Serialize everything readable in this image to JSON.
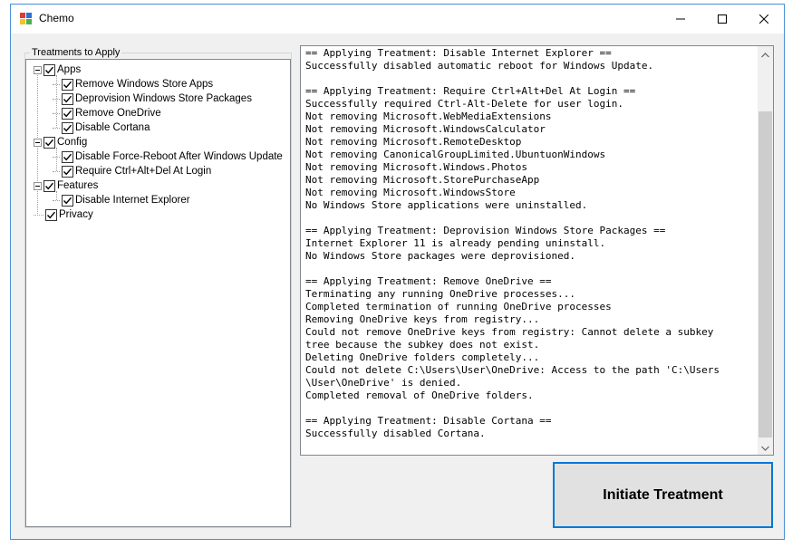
{
  "window": {
    "title": "Chemo",
    "icon": "chemo-app-icon",
    "controls": [
      "minimize-icon",
      "maximize-icon",
      "close-icon"
    ]
  },
  "treatments": {
    "group_label": "Treatments to Apply",
    "nodes": [
      {
        "label": "Apps",
        "checked": true,
        "expanded": true,
        "level": 0
      },
      {
        "label": "Remove Windows Store Apps",
        "checked": true,
        "level": 1
      },
      {
        "label": "Deprovision Windows Store Packages",
        "checked": true,
        "level": 1
      },
      {
        "label": "Remove OneDrive",
        "checked": true,
        "level": 1
      },
      {
        "label": "Disable Cortana",
        "checked": true,
        "level": 1
      },
      {
        "label": "Config",
        "checked": true,
        "expanded": true,
        "level": 0
      },
      {
        "label": "Disable Force-Reboot After Windows Update",
        "checked": true,
        "level": 1
      },
      {
        "label": "Require Ctrl+Alt+Del At Login",
        "checked": true,
        "level": 1
      },
      {
        "label": "Features",
        "checked": true,
        "expanded": true,
        "level": 0
      },
      {
        "label": "Disable Internet Explorer",
        "checked": true,
        "level": 1
      },
      {
        "label": "Privacy",
        "checked": true,
        "level": 0
      }
    ]
  },
  "log": {
    "lines": [
      "== Applying Treatment: Disable Internet Explorer ==",
      "Successfully disabled automatic reboot for Windows Update.",
      "",
      "== Applying Treatment: Require Ctrl+Alt+Del At Login ==",
      "Successfully required Ctrl-Alt-Delete for user login.",
      "Not removing Microsoft.WebMediaExtensions",
      "Not removing Microsoft.WindowsCalculator",
      "Not removing Microsoft.RemoteDesktop",
      "Not removing CanonicalGroupLimited.UbuntuonWindows",
      "Not removing Microsoft.Windows.Photos",
      "Not removing Microsoft.StorePurchaseApp",
      "Not removing Microsoft.WindowsStore",
      "No Windows Store applications were uninstalled.",
      "",
      "== Applying Treatment: Deprovision Windows Store Packages ==",
      "Internet Explorer 11 is already pending uninstall.",
      "No Windows Store packages were deprovisioned.",
      "",
      "== Applying Treatment: Remove OneDrive ==",
      "Terminating any running OneDrive processes...",
      "Completed termination of running OneDrive processes",
      "Removing OneDrive keys from registry...",
      "Could not remove OneDrive keys from registry: Cannot delete a subkey",
      "tree because the subkey does not exist.",
      "Deleting OneDrive folders completely...",
      "Could not delete C:\\Users\\User\\OneDrive: Access to the path 'C:\\Users",
      "\\User\\OneDrive' is denied.",
      "Completed removal of OneDrive folders.",
      "",
      "== Applying Treatment: Disable Cortana ==",
      "Successfully disabled Cortana."
    ]
  },
  "actions": {
    "initiate_label": "Initiate Treatment"
  },
  "colors": {
    "accent": "#0078d7",
    "window_bg": "#f0f0f0",
    "button_bg": "#e1e1e1"
  }
}
